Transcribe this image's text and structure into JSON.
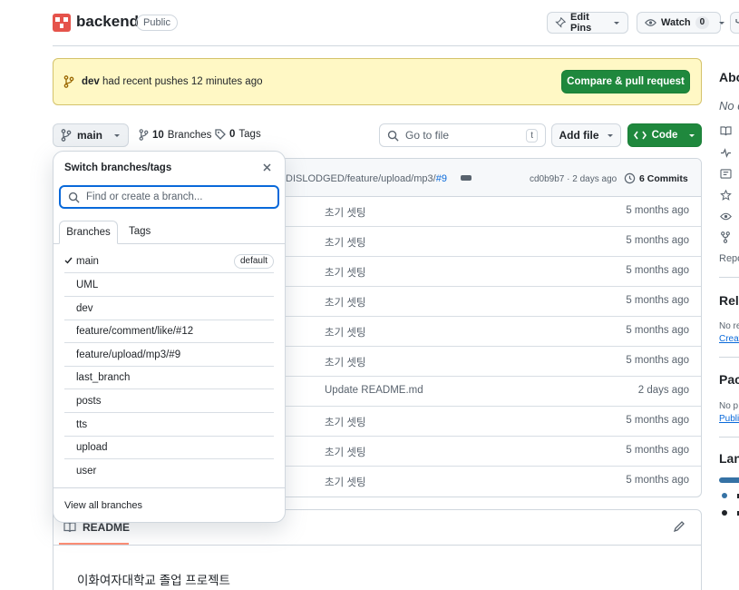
{
  "repo": {
    "name": "backend",
    "visibility": "Public"
  },
  "header_actions": {
    "edit_pins": "Edit Pins",
    "watch": "Watch",
    "watch_count": "0"
  },
  "banner": {
    "branch": "dev",
    "message": "had recent pushes 12 minutes ago",
    "compare_button": "Compare & pull request"
  },
  "toolbar": {
    "current_branch": "main",
    "branches_count": "10",
    "branches_label": "Branches",
    "tags_count": "0",
    "tags_label": "Tags",
    "goto_placeholder": "Go to file",
    "goto_shortcut": "t",
    "add_file": "Add file",
    "code": "Code"
  },
  "latest_commit": {
    "message_prefix": "DISLODGED/feature/upload/mp3/",
    "pr": "#9",
    "hash": "cd0b9b7",
    "time": "· 2 days ago",
    "commits_label": "6 Commits"
  },
  "files": [
    {
      "message": "초기 셋팅",
      "age": "5 months ago"
    },
    {
      "message": "초기 셋팅",
      "age": "5 months ago"
    },
    {
      "message": "초기 셋팅",
      "age": "5 months ago"
    },
    {
      "message": "초기 셋팅",
      "age": "5 months ago"
    },
    {
      "message": "초기 셋팅",
      "age": "5 months ago"
    },
    {
      "message": "초기 셋팅",
      "age": "5 months ago"
    },
    {
      "message": "Update README.md",
      "age": "2 days ago"
    },
    {
      "message": "초기 셋팅",
      "age": "5 months ago"
    },
    {
      "message": "초기 셋팅",
      "age": "5 months ago"
    },
    {
      "message": "초기 셋팅",
      "age": "5 months ago"
    }
  ],
  "readme": {
    "tab": "README",
    "text": "이화여자대학교 졸업 프로젝트"
  },
  "sidebar": {
    "about": "Abo",
    "about_desc": "No d",
    "repo_label": "Repo",
    "releases": "Rele",
    "releases_text": "No re",
    "releases_link": "Creat",
    "packages": "Pack",
    "packages_text": "No p",
    "packages_link": "Publi",
    "languages": "Lang",
    "language_colors": [
      "#3572a5",
      "#1f2328"
    ]
  },
  "branch_dropdown": {
    "title": "Switch branches/tags",
    "placeholder": "Find or create a branch...",
    "tab_branches": "Branches",
    "tab_tags": "Tags",
    "default_badge": "default",
    "branches": [
      "main",
      "UML",
      "dev",
      "feature/comment/like/#12",
      "feature/upload/mp3/#9",
      "last_branch",
      "posts",
      "tts",
      "upload",
      "user"
    ],
    "view_all": "View all branches"
  }
}
